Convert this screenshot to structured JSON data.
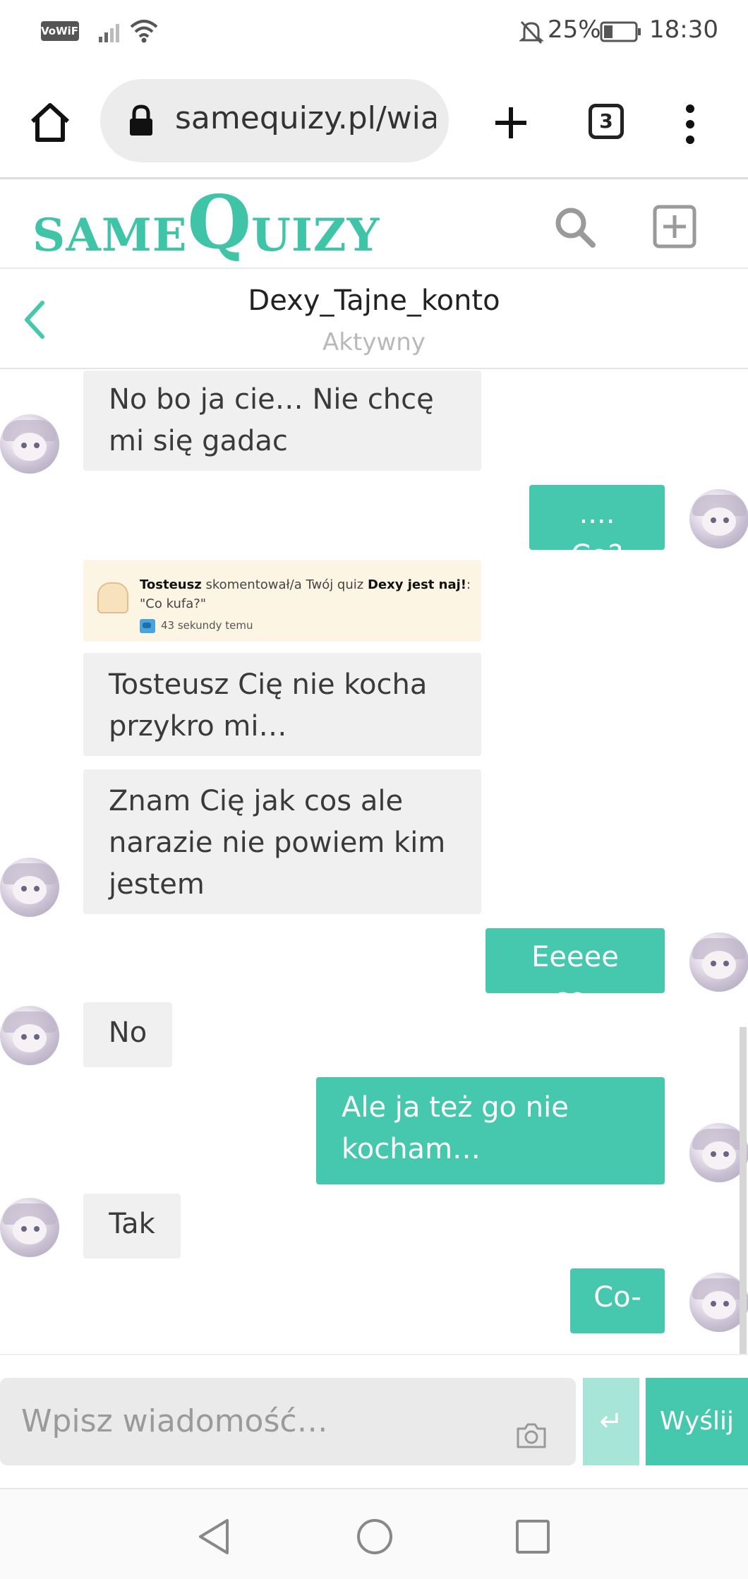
{
  "status_bar": {
    "vowifi": "VoWiFi",
    "battery": "25%",
    "time": "18:30"
  },
  "browser": {
    "url": "samequizy.pl/wia",
    "tab_count": "3"
  },
  "site": {
    "logo_same": "SAME",
    "logo_q": "Q",
    "logo_uizy": "UIZY",
    "brand_color": "#45c8ad"
  },
  "chat": {
    "name": "Dexy_Tajne_konto",
    "status": "Aktywny"
  },
  "messages": [
    {
      "side": "in",
      "text": "No bo ja cie… Nie chcę mi się gadac"
    },
    {
      "side": "out",
      "text": ".... Co?"
    },
    {
      "side": "in",
      "text": "Tosteusz Cię nie kocha przykro mi…"
    },
    {
      "side": "in",
      "text": "Znam Cię jak cos ale narazie nie powiem kim jestem"
    },
    {
      "side": "out",
      "text": "Eeeee co-"
    },
    {
      "side": "in",
      "text": "No"
    },
    {
      "side": "out",
      "text": "Ale ja też go nie kocham…"
    },
    {
      "side": "in",
      "text": "Tak"
    },
    {
      "side": "out",
      "text": "Co-"
    }
  ],
  "notification": {
    "user": "Tosteusz",
    "action": " skomentował/a Twój quiz ",
    "quiz": "Dexy jest naj!",
    "colon": ":",
    "comment": "\"Co kufa?\"",
    "time": "43 sekundy temu"
  },
  "composer": {
    "placeholder": "Wpisz wiadomość…",
    "enter_symbol": "↵",
    "send_label": "Wyślij"
  }
}
